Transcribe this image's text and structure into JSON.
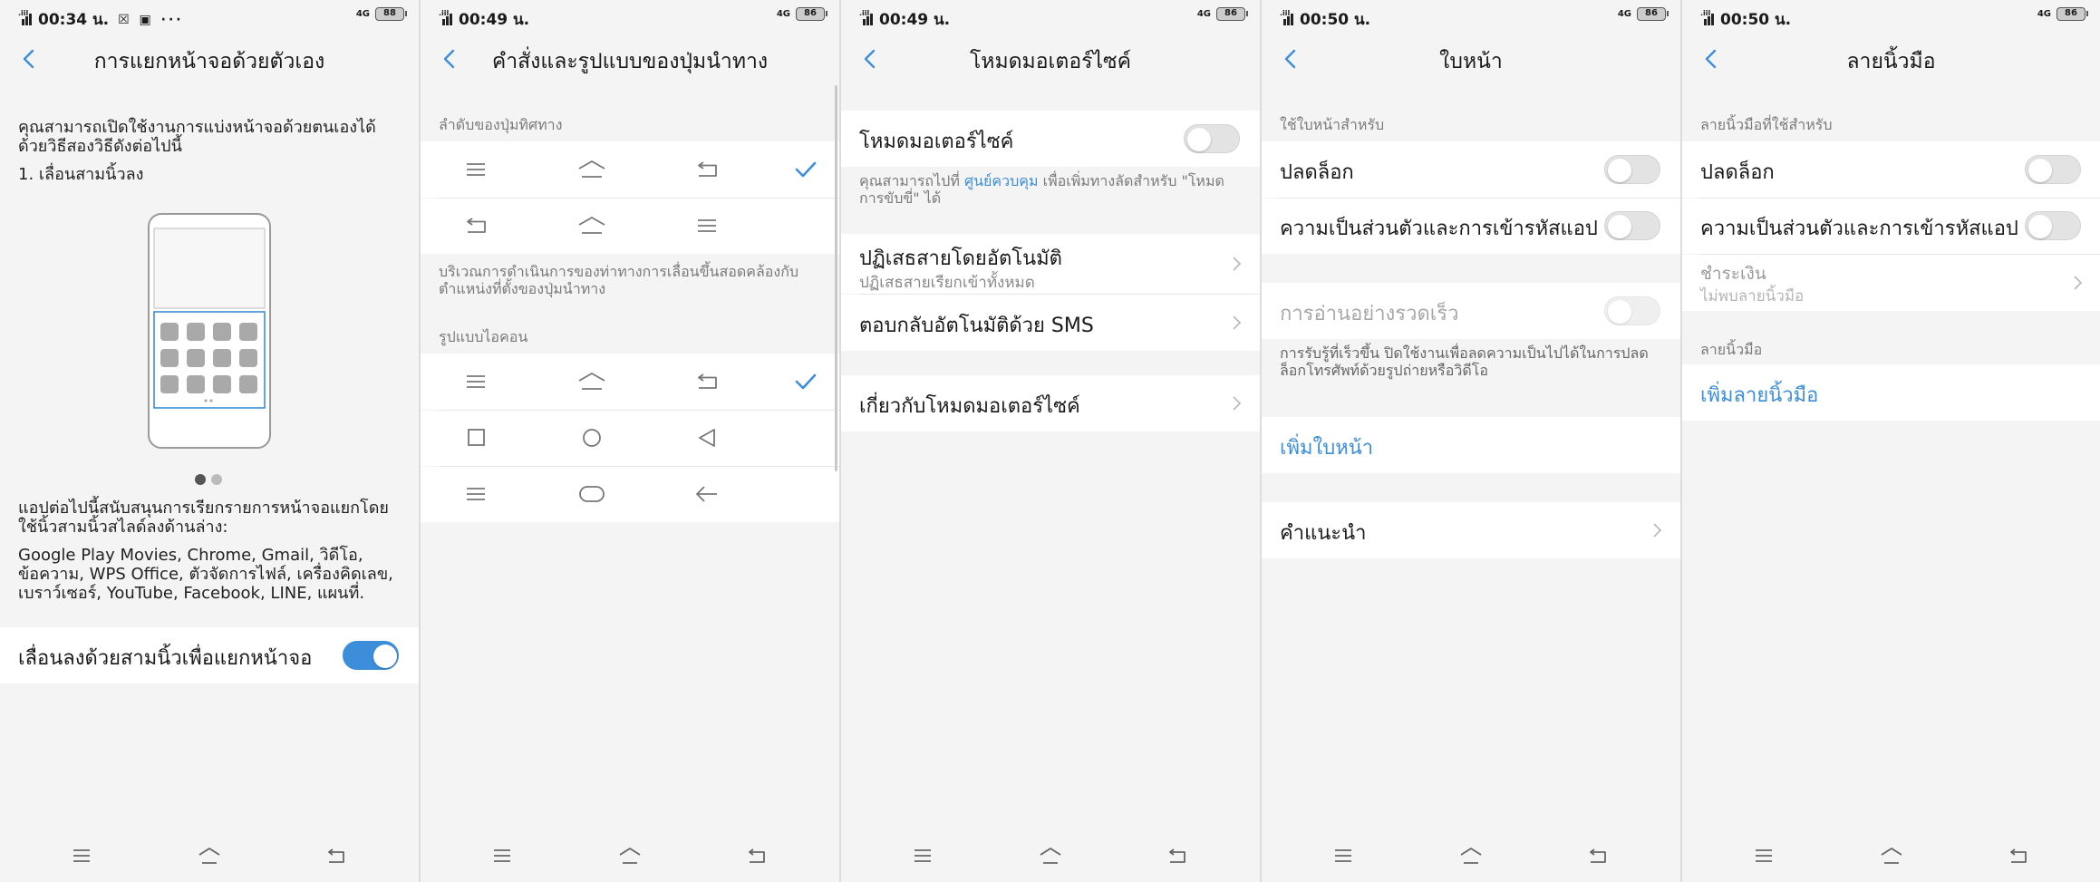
{
  "colors": {
    "accent": "#3c8edb",
    "background": "#f4f4f4",
    "card": "#ffffff",
    "muted_text": "#7a7a7a"
  },
  "navbar": {
    "icons": [
      "menu-icon",
      "home-icon",
      "back-icon"
    ]
  },
  "screen1": {
    "status": {
      "time": "00:34 น.",
      "icons": "☒ ▣ ···",
      "network": "4G",
      "battery": "88"
    },
    "title": "การแยกหน้าจอด้วยตัวเอง",
    "intro": "คุณสามารถเปิดใช้งานการแบ่งหน้าจอด้วยตนเองได้ด้วยวิธีสองวิธีดังต่อไปนี้",
    "step": "1. เลื่อนสามนิ้วลง",
    "supported_header": "แอปต่อไปนี้สนับสนุนการเรียกรายการหน้าจอแยกโดยใช้นิ้วสามนิ้วสไลด์ลงด้านล่าง:",
    "apps_line1": "Google Play Movies,  Chrome,  Gmail,  วิดีโอ,",
    "apps_line2": "ข้อความ,  WPS Office,  ตัวจัดการไฟล์,  เครื่องคิดเลข,",
    "apps_line3": "เบราว์เซอร์,  YouTube,  Facebook,  LINE,  แผนที่.",
    "toggle_label": "เลื่อนลงด้วยสามนิ้วเพื่อแยกหน้าจอ",
    "toggle_on": true,
    "page_indicator": {
      "pages": 2,
      "current": 1
    }
  },
  "screen2": {
    "status": {
      "time": "00:49 น.",
      "network": "4G",
      "battery": "86"
    },
    "title": "คำสั่งและรูปแบบของปุ่มนำทาง",
    "section1": "ลำดับของปุ่มทิศทาง",
    "note": "บริเวณการดำเนินการของท่าทางการเลื่อนขึ้นสอดคล้องกับตำแหน่งที่ตั้งของปุ่มนำทาง",
    "section2": "รูปแบบไอคอน",
    "order_rows": [
      {
        "icons": [
          "menu-icon",
          "home-icon",
          "back-icon"
        ],
        "selected": true
      },
      {
        "icons": [
          "back-icon",
          "home-icon",
          "menu-icon"
        ],
        "selected": false
      }
    ],
    "style_rows": [
      {
        "icons": [
          "menu-icon",
          "home-icon",
          "back-icon"
        ],
        "selected": true
      },
      {
        "icons": [
          "square-icon",
          "circle-icon",
          "triangle-icon"
        ],
        "selected": false
      },
      {
        "icons": [
          "menu-icon",
          "pill-icon",
          "arrow-left-icon"
        ],
        "selected": false
      }
    ]
  },
  "screen3": {
    "status": {
      "time": "00:49 น.",
      "network": "4G",
      "battery": "86"
    },
    "title": "โหมดมอเตอร์ไซค์",
    "toggle_label": "โหมดมอเตอร์ไซค์",
    "toggle_on": false,
    "desc_prefix": "คุณสามารถไปที่ ",
    "desc_link": "ศูนย์ควบคุม",
    "desc_suffix": " เพื่อเพิ่มทางลัดสำหรับ \"โหมด",
    "desc_line2": "การขับขี่\" ได้",
    "auto_reject_title": "ปฏิเสธสายโดยอัตโนมัติ",
    "auto_reject_sub": "ปฏิเสธสายเรียกเข้าทั้งหมด",
    "auto_reply": "ตอบกลับอัตโนมัติด้วย SMS",
    "about": "เกี่ยวกับโหมดมอเตอร์ไซค์"
  },
  "screen4": {
    "status": {
      "time": "00:50 น.",
      "network": "4G",
      "battery": "86"
    },
    "title": "ใบหน้า",
    "section": "ใช้ใบหน้าสำหรับ",
    "unlock": "ปลดล็อก",
    "unlock_on": false,
    "privacy": "ความเป็นส่วนตัวและการเข้ารหัสแอป",
    "privacy_on": false,
    "quick_read": "การอ่านอย่างรวดเร็ว",
    "quick_read_note_line1": "การรับรู้ที่เร็วขึ้น ปิดใช้งานเพื่อลดความเป็นไปได้ในการปลด",
    "quick_read_note_line2": "ล็อกโทรศัพท์ด้วยรูปถ่ายหรือวิดีโอ",
    "add_face": "เพิ่มใบหน้า",
    "tips": "คำแนะนำ"
  },
  "screen5": {
    "status": {
      "time": "00:50 น.",
      "network": "4G",
      "battery": "86"
    },
    "title": "ลายนิ้วมือ",
    "section": "ลายนิ้วมือที่ใช้สำหรับ",
    "unlock": "ปลดล็อก",
    "unlock_on": false,
    "privacy": "ความเป็นส่วนตัวและการเข้ารหัสแอป",
    "privacy_on": false,
    "payment": "ชำระเงิน",
    "payment_sub": "ไม่พบลายนิ้วมือ",
    "fingerprint_section": "ลายนิ้วมือ",
    "add_fingerprint": "เพิ่มลายนิ้วมือ"
  }
}
